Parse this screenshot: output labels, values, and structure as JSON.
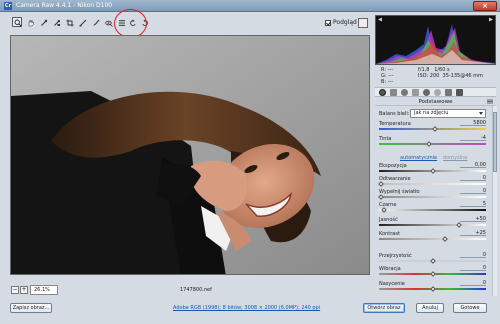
{
  "window": {
    "title": "Camera Raw 4.4.1  -  Nikon D100"
  },
  "toolbar": {
    "tools": [
      "zoom-tool",
      "hand-tool",
      "white-balance-tool",
      "color-sampler-tool",
      "crop-tool",
      "straighten-tool",
      "retouch-tool",
      "red-eye-tool",
      "preferences-tool",
      "rotate-left-tool",
      "rotate-right-tool"
    ],
    "preview_label": "Podgląd",
    "preview_checked": true
  },
  "image": {
    "filename": "1747800.nef",
    "zoom": "26,1%"
  },
  "info": {
    "r_label": "R:",
    "g_label": "G:",
    "b_label": "B:",
    "r_value": "---",
    "g_value": "---",
    "b_value": "---",
    "aperture": "f/1,8",
    "shutter": "1/60 s",
    "iso": "ISO: 200",
    "lens": "35-135@46 mm"
  },
  "panel": {
    "section_title": "Podstawowe",
    "wb_label": "Balans bieli:",
    "wb_value": "Jak na zdjęciu",
    "auto_link": "automatycznie",
    "default_link": "domyślne",
    "sliders": [
      {
        "label": "Temperatura",
        "value": "5800",
        "pos": 0.52
      },
      {
        "label": "Tinta",
        "value": "-4",
        "pos": 0.47
      },
      {
        "label": "Ekspozycja",
        "value": "0,00",
        "pos": 0.5
      },
      {
        "label": "Odtwarzanie",
        "value": "0",
        "pos": 0.02
      },
      {
        "label": "Wypełnij światło",
        "value": "0",
        "pos": 0.02
      },
      {
        "label": "Czarne",
        "value": "5",
        "pos": 0.05
      },
      {
        "label": "Jasność",
        "value": "+50",
        "pos": 0.75
      },
      {
        "label": "Kontrast",
        "value": "+25",
        "pos": 0.62
      },
      {
        "label": "Przejrzystość",
        "value": "0",
        "pos": 0.5
      },
      {
        "label": "Wibracja",
        "value": "0",
        "pos": 0.5
      },
      {
        "label": "Nasycenie",
        "value": "0",
        "pos": 0.5
      }
    ]
  },
  "bottom": {
    "save_label": "Zapisz obraz...",
    "info_link": "Adobe RGB (1998); 8 bitów; 3008 × 2000 (6,0MP); 240 ppi",
    "open_label": "Otwórz obraz",
    "cancel_label": "Anuluj",
    "done_label": "Gotowe"
  },
  "colors": {
    "highlight_circle": "#d42424",
    "link": "#1a56b0",
    "accent": "#3a78c2"
  }
}
